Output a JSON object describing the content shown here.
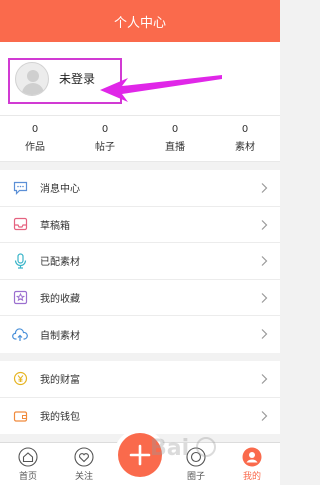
{
  "header": {
    "title": "个人中心"
  },
  "profile": {
    "status": "未登录"
  },
  "stats": [
    {
      "value": "0",
      "label": "作品"
    },
    {
      "value": "0",
      "label": "帖子"
    },
    {
      "value": "0",
      "label": "直播"
    },
    {
      "value": "0",
      "label": "素材"
    }
  ],
  "menu_group1": [
    {
      "label": "消息中心",
      "icon": "message-icon"
    },
    {
      "label": "草稿箱",
      "icon": "draft-box-icon"
    },
    {
      "label": "已配素材",
      "icon": "microphone-icon"
    },
    {
      "label": "我的收藏",
      "icon": "star-icon"
    },
    {
      "label": "自制素材",
      "icon": "cloud-upload-icon"
    }
  ],
  "menu_group2": [
    {
      "label": "我的财富",
      "icon": "yuan-coin-icon"
    },
    {
      "label": "我的钱包",
      "icon": "wallet-icon"
    }
  ],
  "tabbar": [
    {
      "label": "首页",
      "icon": "home-icon"
    },
    {
      "label": "关注",
      "icon": "heart-icon"
    },
    {
      "label": "圈子",
      "icon": "circle-icon"
    },
    {
      "label": "我的",
      "icon": "profile-icon"
    }
  ],
  "colors": {
    "accent": "#fa6a4c",
    "highlight": "#d13ad3"
  }
}
